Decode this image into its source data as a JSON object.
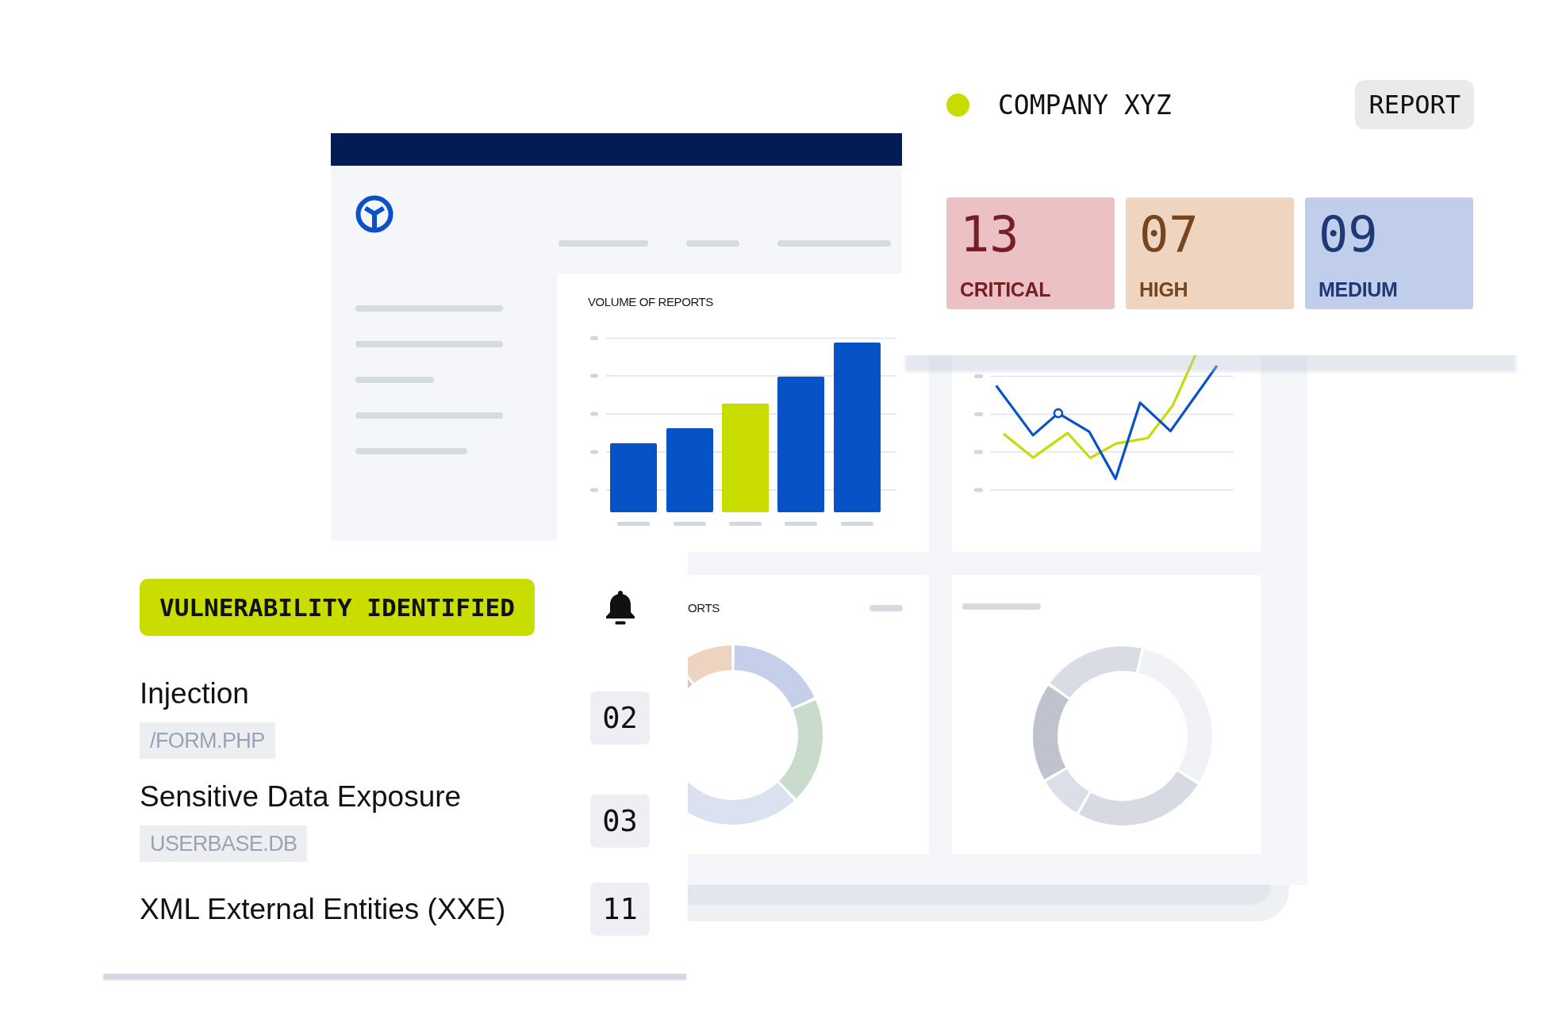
{
  "company": {
    "name": "COMPANY XYZ",
    "report_button": "REPORT"
  },
  "severity_counts": [
    {
      "count": "13",
      "label": "CRITICAL",
      "color": "#ebc1c4"
    },
    {
      "count": "07",
      "label": "HIGH",
      "color": "#efd5c0"
    },
    {
      "count": "09",
      "label": "MEDIUM",
      "color": "#c0cdeb"
    }
  ],
  "dashboard": {
    "bar_panel": {
      "title": "VOLUME OF REPORTS"
    },
    "donut_panel": {
      "title": "ORTS"
    }
  },
  "alert": {
    "badge": "VULNERABILITY IDENTIFIED",
    "items": [
      {
        "name": "Injection",
        "location": "/FORM.PHP",
        "count": "02"
      },
      {
        "name": "Sensitive Data Exposure",
        "location": "USERBASE.DB",
        "count": "03"
      },
      {
        "name": "XML External Entities (XXE)",
        "count": "11"
      }
    ]
  }
}
